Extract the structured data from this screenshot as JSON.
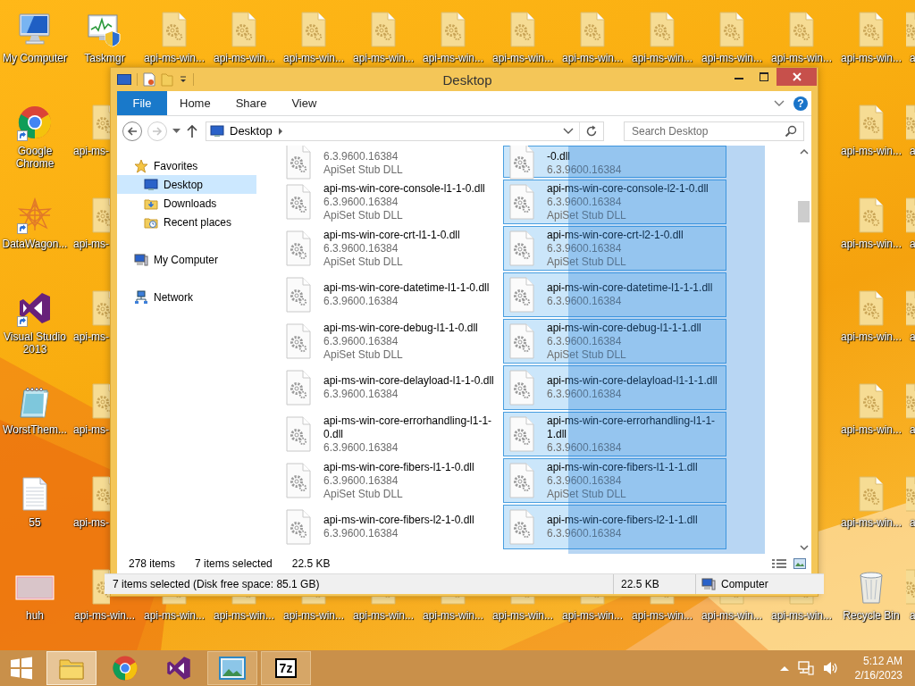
{
  "desktop": {
    "rows": [
      [
        {
          "label": "My Computer",
          "kind": "computer",
          "shortcut": false
        },
        {
          "label": "Taskmgr",
          "kind": "taskmgr",
          "shortcut": false
        },
        {
          "label": "api-ms-win...",
          "kind": "dll",
          "shortcut": false
        },
        {
          "label": "api-ms-win...",
          "kind": "dll",
          "shortcut": false
        },
        {
          "label": "api-ms-win...",
          "kind": "dll",
          "shortcut": false
        },
        {
          "label": "api-ms-win...",
          "kind": "dll",
          "shortcut": false
        },
        {
          "label": "api-ms-win...",
          "kind": "dll",
          "shortcut": false
        },
        {
          "label": "api-ms-win...",
          "kind": "dll",
          "shortcut": false
        },
        {
          "label": "api-ms-win...",
          "kind": "dll",
          "shortcut": false
        },
        {
          "label": "api-ms-win...",
          "kind": "dll",
          "shortcut": false
        },
        {
          "label": "api-ms-win...",
          "kind": "dll",
          "shortcut": false
        },
        {
          "label": "api-ms-win...",
          "kind": "dll",
          "shortcut": false
        },
        {
          "label": "api-ms-win...",
          "kind": "dll",
          "shortcut": false
        },
        {
          "label": "a",
          "kind": "dll",
          "shortcut": false
        }
      ],
      [
        {
          "label": "Google Chrome",
          "kind": "chrome",
          "shortcut": true
        },
        {
          "label": "api-ms-",
          "kind": "dll",
          "shortcut": false
        },
        null,
        null,
        null,
        null,
        null,
        null,
        null,
        null,
        null,
        null,
        {
          "label": "api-ms-win...",
          "kind": "dll",
          "shortcut": false
        },
        {
          "label": "a",
          "kind": "dll",
          "shortcut": false
        }
      ],
      [
        {
          "label": "DataWagon...",
          "kind": "datawagon",
          "shortcut": true
        },
        {
          "label": "api-ms-",
          "kind": "dll",
          "shortcut": false
        },
        null,
        null,
        null,
        null,
        null,
        null,
        null,
        null,
        null,
        null,
        {
          "label": "api-ms-win...",
          "kind": "dll",
          "shortcut": false
        },
        {
          "label": "a",
          "kind": "dll",
          "shortcut": false
        }
      ],
      [
        {
          "label": "Visual Studio 2013",
          "kind": "vs",
          "shortcut": true
        },
        {
          "label": "api-ms-",
          "kind": "dll",
          "shortcut": false
        },
        null,
        null,
        null,
        null,
        null,
        null,
        null,
        null,
        null,
        null,
        {
          "label": "api-ms-win...",
          "kind": "dll",
          "shortcut": false
        },
        {
          "label": "a",
          "kind": "dll",
          "shortcut": false
        }
      ],
      [
        {
          "label": "WorstThem...",
          "kind": "notepad",
          "shortcut": false
        },
        {
          "label": "api-ms-",
          "kind": "dll",
          "shortcut": false
        },
        null,
        null,
        null,
        null,
        null,
        null,
        null,
        null,
        null,
        null,
        {
          "label": "api-ms-win...",
          "kind": "dll",
          "shortcut": false
        },
        {
          "label": "a",
          "kind": "dll",
          "shortcut": false
        }
      ],
      [
        {
          "label": "55",
          "kind": "textfile",
          "shortcut": false
        },
        {
          "label": "api-ms-",
          "kind": "dll",
          "shortcut": false
        },
        null,
        null,
        null,
        null,
        null,
        null,
        null,
        null,
        null,
        null,
        {
          "label": "api-ms-win...",
          "kind": "dll",
          "shortcut": false
        },
        {
          "label": "a",
          "kind": "dll",
          "shortcut": false
        }
      ],
      [
        {
          "label": "huh",
          "kind": "image",
          "shortcut": false
        },
        {
          "label": "api-ms-win...",
          "kind": "dll",
          "shortcut": false
        },
        {
          "label": "api-ms-win...",
          "kind": "dll",
          "shortcut": false
        },
        {
          "label": "api-ms-win...",
          "kind": "dll",
          "shortcut": false
        },
        {
          "label": "api-ms-win...",
          "kind": "dll",
          "shortcut": false
        },
        {
          "label": "api-ms-win...",
          "kind": "dll",
          "shortcut": false
        },
        {
          "label": "api-ms-win...",
          "kind": "dll",
          "shortcut": false
        },
        {
          "label": "api-ms-win...",
          "kind": "dll",
          "shortcut": false
        },
        {
          "label": "api-ms-win...",
          "kind": "dll",
          "shortcut": false
        },
        {
          "label": "api-ms-win...",
          "kind": "dll",
          "shortcut": false
        },
        {
          "label": "api-ms-win...",
          "kind": "dll",
          "shortcut": false
        },
        {
          "label": "api-ms-win...",
          "kind": "dll",
          "shortcut": false
        },
        {
          "label": "Recycle Bin",
          "kind": "recycle",
          "shortcut": false
        },
        {
          "label": "a",
          "kind": "dll",
          "shortcut": false
        }
      ]
    ]
  },
  "window": {
    "title": "Desktop",
    "ribbon_tabs": [
      {
        "label": "File",
        "kind": "file"
      },
      {
        "label": "Home",
        "kind": "tab"
      },
      {
        "label": "Share",
        "kind": "tab"
      },
      {
        "label": "View",
        "kind": "tab"
      }
    ],
    "help_glyph": "?",
    "nav_buttons": {
      "back_enabled": true,
      "forward_enabled": false
    },
    "address": "Desktop",
    "search": {
      "placeholder": "Search Desktop"
    },
    "nav_pane": [
      {
        "label": "Favorites",
        "kind": "favorites",
        "selected": false,
        "children": [
          {
            "label": "Desktop",
            "kind": "desktop",
            "selected": true
          },
          {
            "label": "Downloads",
            "kind": "downloads",
            "selected": false
          },
          {
            "label": "Recent places",
            "kind": "recent",
            "selected": false
          }
        ]
      },
      {
        "label": "My Computer",
        "kind": "computer",
        "selected": false
      },
      {
        "label": "Network",
        "kind": "network",
        "selected": false
      }
    ],
    "files": [
      {
        "version": "6.3.9600.16384",
        "description": "ApiSet Stub DLL",
        "selected": false
      },
      {
        "name": "-0.dll",
        "version": "6.3.9600.16384",
        "selected": true
      },
      {
        "name": "api-ms-win-core-console-l1-1-0.dll",
        "version": "6.3.9600.16384",
        "description": "ApiSet Stub DLL",
        "selected": false
      },
      {
        "name": "api-ms-win-core-console-l2-1-0.dll",
        "version": "6.3.9600.16384",
        "description": "ApiSet Stub DLL",
        "selected": true
      },
      {
        "name": "api-ms-win-core-crt-l1-1-0.dll",
        "version": "6.3.9600.16384",
        "description": "ApiSet Stub DLL",
        "selected": false
      },
      {
        "name": "api-ms-win-core-crt-l2-1-0.dll",
        "version": "6.3.9600.16384",
        "description": "ApiSet Stub DLL",
        "selected": true
      },
      {
        "name": "api-ms-win-core-datetime-l1-1-0.dll",
        "version": "6.3.9600.16384",
        "selected": false
      },
      {
        "name": "api-ms-win-core-datetime-l1-1-1.dll",
        "version": "6.3.9600.16384",
        "selected": true
      },
      {
        "name": "api-ms-win-core-debug-l1-1-0.dll",
        "version": "6.3.9600.16384",
        "description": "ApiSet Stub DLL",
        "selected": false
      },
      {
        "name": "api-ms-win-core-debug-l1-1-1.dll",
        "version": "6.3.9600.16384",
        "description": "ApiSet Stub DLL",
        "selected": true
      },
      {
        "name": "api-ms-win-core-delayload-l1-1-0.dll",
        "version": "6.3.9600.16384",
        "selected": false
      },
      {
        "name": "api-ms-win-core-delayload-l1-1-1.dll",
        "version": "6.3.9600.16384",
        "selected": true
      },
      {
        "name": "api-ms-win-core-errorhandling-l1-1-0.dll",
        "version": "6.3.9600.16384",
        "selected": false
      },
      {
        "name": "api-ms-win-core-errorhandling-l1-1-1.dll",
        "version": "6.3.9600.16384",
        "selected": true
      },
      {
        "name": "api-ms-win-core-fibers-l1-1-0.dll",
        "version": "6.3.9600.16384",
        "description": "ApiSet Stub DLL",
        "selected": false
      },
      {
        "name": "api-ms-win-core-fibers-l1-1-1.dll",
        "version": "6.3.9600.16384",
        "description": "ApiSet Stub DLL",
        "selected": true
      },
      {
        "name": "api-ms-win-core-fibers-l2-1-0.dll",
        "version": "6.3.9600.16384",
        "selected": false
      },
      {
        "name": "api-ms-win-core-fibers-l2-1-1.dll",
        "version": "6.3.9600.16384",
        "selected": true
      }
    ],
    "marquee": true,
    "item_count": "278 items",
    "selection_count": "7 items selected",
    "selection_size": "22.5 KB",
    "status_bar": {
      "text": "7 items selected (Disk free space: 85.1 GB)",
      "size": "22.5 KB",
      "location": "Computer"
    }
  },
  "taskbar": {
    "apps": [
      {
        "kind": "explorer",
        "running": true,
        "active": true
      },
      {
        "kind": "chrome",
        "running": false,
        "active": false
      },
      {
        "kind": "vs",
        "running": false,
        "active": false
      },
      {
        "kind": "photos",
        "running": true,
        "active": false
      },
      {
        "kind": "archiver",
        "label": "7z",
        "running": true,
        "active": false
      }
    ],
    "clock": {
      "time": "5:12 AM",
      "date": "2/16/2023"
    }
  }
}
